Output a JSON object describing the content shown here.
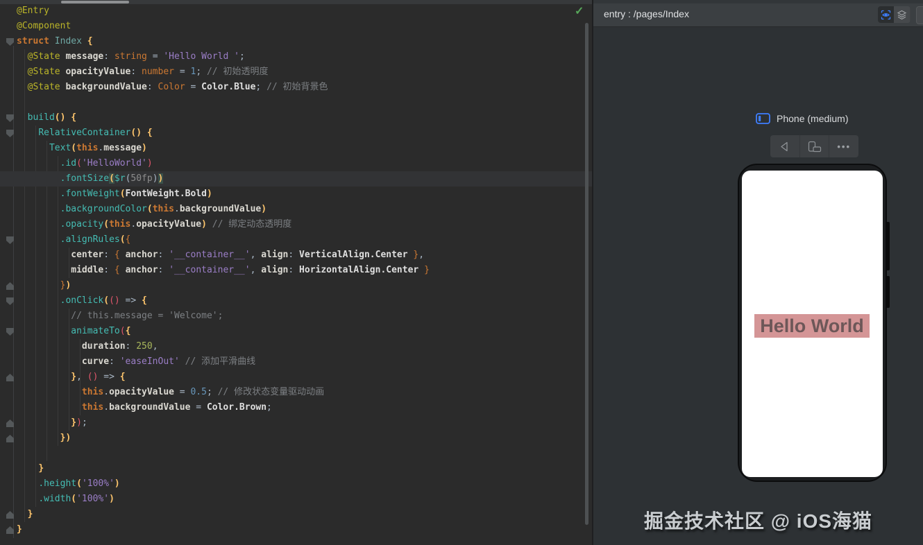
{
  "colors": {
    "accent_blue": "#3E7EFF",
    "editor_bg": "#2B2B2B",
    "panel_bg": "#2D3134",
    "header_bg": "#3B3F42",
    "annotation_yellow": "#BBB529",
    "keyword_orange": "#CC7832",
    "function_teal": "#45BDB4",
    "string_purple": "#9B7EC7",
    "bracket_gold": "#FFC66D",
    "bracket_pink": "#E0566B",
    "check_green": "#57A65A",
    "hello_bg_pink": "#D49596",
    "hello_text": "#6D5758"
  },
  "editor": {
    "current_line": 12,
    "status_icon": "checkmark",
    "check_glyph": "✓",
    "lines": [
      [
        [
          "@Entry",
          "ann"
        ]
      ],
      [
        [
          "@Component",
          "ann"
        ]
      ],
      [
        [
          "struct",
          "kw"
        ],
        [
          " ",
          "pl"
        ],
        [
          "Index",
          "cls"
        ],
        [
          " ",
          "pl"
        ],
        [
          "{",
          "b1"
        ]
      ],
      [
        [
          "  ",
          "pl"
        ],
        [
          "@State",
          "ann"
        ],
        [
          " ",
          "pl"
        ],
        [
          "message",
          "prop"
        ],
        [
          ": ",
          "pl"
        ],
        [
          "string",
          "type"
        ],
        [
          " = ",
          "pl"
        ],
        [
          "'Hello World '",
          "str"
        ],
        [
          ";",
          "pl"
        ]
      ],
      [
        [
          "  ",
          "pl"
        ],
        [
          "@State",
          "ann"
        ],
        [
          " ",
          "pl"
        ],
        [
          "opacityValue",
          "prop"
        ],
        [
          ": ",
          "pl"
        ],
        [
          "number",
          "type"
        ],
        [
          " = ",
          "pl"
        ],
        [
          "1",
          "num"
        ],
        [
          "; ",
          "pl"
        ],
        [
          "// 初始透明度",
          "cmt"
        ]
      ],
      [
        [
          "  ",
          "pl"
        ],
        [
          "@State",
          "ann"
        ],
        [
          " ",
          "pl"
        ],
        [
          "backgroundValue",
          "prop"
        ],
        [
          ": ",
          "pl"
        ],
        [
          "Color",
          "type"
        ],
        [
          " = ",
          "pl"
        ],
        [
          "Color.Blue",
          "bold"
        ],
        [
          "; ",
          "pl"
        ],
        [
          "// 初始背景色",
          "cmt"
        ]
      ],
      [],
      [
        [
          "  ",
          "pl"
        ],
        [
          "build",
          "fn"
        ],
        [
          "()",
          "b1"
        ],
        [
          " ",
          "pl"
        ],
        [
          "{",
          "b1"
        ]
      ],
      [
        [
          "    ",
          "pl"
        ],
        [
          "RelativeContainer",
          "fn"
        ],
        [
          "()",
          "b1"
        ],
        [
          " ",
          "pl"
        ],
        [
          "{",
          "b1"
        ]
      ],
      [
        [
          "      ",
          "pl"
        ],
        [
          "Text",
          "fn"
        ],
        [
          "(",
          "b1"
        ],
        [
          "this",
          "kw"
        ],
        [
          ".",
          "pl"
        ],
        [
          "message",
          "prop"
        ],
        [
          ")",
          "b1"
        ]
      ],
      [
        [
          "        ",
          "pl"
        ],
        [
          ".id",
          "fn"
        ],
        [
          "(",
          "b3"
        ],
        [
          "'HelloWorld'",
          "str"
        ],
        [
          ")",
          "b3"
        ]
      ],
      [
        [
          "        ",
          "pl"
        ],
        [
          ".fontSize",
          "fn"
        ],
        [
          "(",
          "b1 phl"
        ],
        [
          "$r",
          "fn"
        ],
        [
          "(",
          "pl"
        ],
        [
          "50fp",
          "gr"
        ],
        [
          ")",
          "pl"
        ],
        [
          ")",
          "b1 phl"
        ]
      ],
      [
        [
          "        ",
          "pl"
        ],
        [
          ".fontWeight",
          "fn"
        ],
        [
          "(",
          "b1"
        ],
        [
          "FontWeight.Bold",
          "bold"
        ],
        [
          ")",
          "b1"
        ]
      ],
      [
        [
          "        ",
          "pl"
        ],
        [
          ".backgroundColor",
          "fn"
        ],
        [
          "(",
          "b1"
        ],
        [
          "this",
          "kw"
        ],
        [
          ".",
          "pl"
        ],
        [
          "backgroundValue",
          "prop"
        ],
        [
          ")",
          "b1"
        ]
      ],
      [
        [
          "        ",
          "pl"
        ],
        [
          ".opacity",
          "fn"
        ],
        [
          "(",
          "b1"
        ],
        [
          "this",
          "kw"
        ],
        [
          ".",
          "pl"
        ],
        [
          "opacityValue",
          "prop"
        ],
        [
          ")",
          "b1"
        ],
        [
          " ",
          "pl"
        ],
        [
          "// 绑定动态透明度",
          "cmt"
        ]
      ],
      [
        [
          "        ",
          "pl"
        ],
        [
          ".alignRules",
          "fn"
        ],
        [
          "(",
          "b1"
        ],
        [
          "{",
          "b2"
        ]
      ],
      [
        [
          "          ",
          "pl"
        ],
        [
          "center",
          "prop"
        ],
        [
          ": ",
          "pl"
        ],
        [
          "{",
          "b2"
        ],
        [
          " ",
          "pl"
        ],
        [
          "anchor",
          "prop"
        ],
        [
          ": ",
          "pl"
        ],
        [
          "'__container__'",
          "str"
        ],
        [
          ", ",
          "pl"
        ],
        [
          "align",
          "prop"
        ],
        [
          ": ",
          "pl"
        ],
        [
          "VerticalAlign.Center",
          "bold"
        ],
        [
          " ",
          "pl"
        ],
        [
          "}",
          "b2"
        ],
        [
          ",",
          "pl"
        ]
      ],
      [
        [
          "          ",
          "pl"
        ],
        [
          "middle",
          "prop"
        ],
        [
          ": ",
          "pl"
        ],
        [
          "{",
          "b2"
        ],
        [
          " ",
          "pl"
        ],
        [
          "anchor",
          "prop"
        ],
        [
          ": ",
          "pl"
        ],
        [
          "'__container__'",
          "str"
        ],
        [
          ", ",
          "pl"
        ],
        [
          "align",
          "prop"
        ],
        [
          ": ",
          "pl"
        ],
        [
          "HorizontalAlign.Center",
          "bold"
        ],
        [
          " ",
          "pl"
        ],
        [
          "}",
          "b2"
        ]
      ],
      [
        [
          "        ",
          "pl"
        ],
        [
          "}",
          "b2"
        ],
        [
          ")",
          "b1"
        ]
      ],
      [
        [
          "        ",
          "pl"
        ],
        [
          ".onClick",
          "fn"
        ],
        [
          "(",
          "b1"
        ],
        [
          "()",
          "b3"
        ],
        [
          " => ",
          "pl"
        ],
        [
          "{",
          "b1"
        ]
      ],
      [
        [
          "          ",
          "pl"
        ],
        [
          "// this.message = 'Welcome';",
          "cmt"
        ]
      ],
      [
        [
          "          ",
          "pl"
        ],
        [
          "animateTo",
          "fn"
        ],
        [
          "(",
          "b3"
        ],
        [
          "{",
          "b1"
        ]
      ],
      [
        [
          "            ",
          "pl"
        ],
        [
          "duration",
          "prop"
        ],
        [
          ": ",
          "pl"
        ],
        [
          "250",
          "num2"
        ],
        [
          ",",
          "pl"
        ]
      ],
      [
        [
          "            ",
          "pl"
        ],
        [
          "curve",
          "prop"
        ],
        [
          ": ",
          "pl"
        ],
        [
          "'easeInOut'",
          "str"
        ],
        [
          " ",
          "pl"
        ],
        [
          "// 添加平滑曲线",
          "cmt"
        ]
      ],
      [
        [
          "          ",
          "pl"
        ],
        [
          "}",
          "b1"
        ],
        [
          ", ",
          "pl"
        ],
        [
          "()",
          "b3"
        ],
        [
          " => ",
          "pl"
        ],
        [
          "{",
          "b1"
        ]
      ],
      [
        [
          "            ",
          "pl"
        ],
        [
          "this",
          "kw"
        ],
        [
          ".",
          "pl"
        ],
        [
          "opacityValue",
          "prop"
        ],
        [
          " = ",
          "pl"
        ],
        [
          "0.5",
          "num"
        ],
        [
          "; ",
          "pl"
        ],
        [
          "// 修改状态变量驱动动画",
          "cmt"
        ]
      ],
      [
        [
          "            ",
          "pl"
        ],
        [
          "this",
          "kw"
        ],
        [
          ".",
          "pl"
        ],
        [
          "backgroundValue",
          "prop"
        ],
        [
          " = ",
          "pl"
        ],
        [
          "Color.Brown",
          "bold"
        ],
        [
          ";",
          "pl"
        ]
      ],
      [
        [
          "          ",
          "pl"
        ],
        [
          "}",
          "b1"
        ],
        [
          ")",
          "b3"
        ],
        [
          ";",
          "pl"
        ]
      ],
      [
        [
          "        ",
          "pl"
        ],
        [
          "}",
          "b1"
        ],
        [
          ")",
          "b1"
        ]
      ],
      [],
      [
        [
          "    ",
          "pl"
        ],
        [
          "}",
          "b1"
        ]
      ],
      [
        [
          "    ",
          "pl"
        ],
        [
          ".height",
          "fn"
        ],
        [
          "(",
          "b1"
        ],
        [
          "'100%'",
          "str"
        ],
        [
          ")",
          "b1"
        ]
      ],
      [
        [
          "    ",
          "pl"
        ],
        [
          ".width",
          "fn"
        ],
        [
          "(",
          "b1"
        ],
        [
          "'100%'",
          "str"
        ],
        [
          ")",
          "b1"
        ]
      ],
      [
        [
          "  ",
          "pl"
        ],
        [
          "}",
          "b1"
        ]
      ],
      [
        [
          "}",
          "b1"
        ]
      ]
    ],
    "fold_markers": [
      {
        "line": 3,
        "dir": "down"
      },
      {
        "line": 8,
        "dir": "down"
      },
      {
        "line": 9,
        "dir": "down"
      },
      {
        "line": 16,
        "dir": "down"
      },
      {
        "line": 20,
        "dir": "down"
      },
      {
        "line": 22,
        "dir": "down"
      },
      {
        "line": 19,
        "dir": "up"
      },
      {
        "line": 25,
        "dir": "up"
      },
      {
        "line": 28,
        "dir": "up"
      },
      {
        "line": 29,
        "dir": "up"
      },
      {
        "line": 34,
        "dir": "up"
      },
      {
        "line": 35,
        "dir": "up"
      }
    ]
  },
  "preview": {
    "header": {
      "title": "entry : /pages/Index"
    },
    "device": {
      "label": "Phone (medium)"
    },
    "toolbar": {
      "more_label": "•••"
    },
    "screen": {
      "text": "Hello World"
    },
    "watermark": "掘金技术社区 @ iOS海猫"
  }
}
